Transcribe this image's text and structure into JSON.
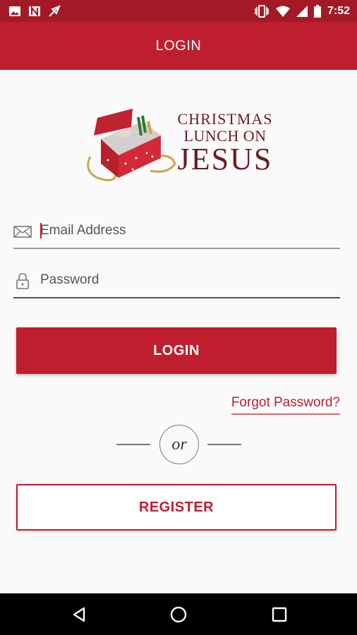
{
  "status_bar": {
    "time": "7:52",
    "left_icons": [
      "image-icon",
      "n-app-icon",
      "feather-icon"
    ],
    "right_icons": [
      "vibrate-icon",
      "wifi-icon",
      "cell-signal-icon",
      "battery-icon"
    ]
  },
  "app_bar": {
    "title": "LOGIN"
  },
  "logo": {
    "line1": "CHRISTMAS",
    "line2": "LUNCH ON",
    "line3": "JESUS",
    "image_icon": "gift-box-icon"
  },
  "form": {
    "email": {
      "placeholder": "Email Address",
      "value": "",
      "icon": "envelope-icon"
    },
    "password": {
      "placeholder": "Password",
      "value": "",
      "icon": "lock-icon"
    },
    "login_label": "LOGIN",
    "forgot_label": "Forgot Password?",
    "divider_text": "or",
    "register_label": "REGISTER"
  },
  "nav_bar": {
    "icons": [
      "back-icon",
      "home-icon",
      "recents-icon"
    ]
  },
  "colors": {
    "primary": "#be1e2d",
    "status_bar": "#a31a26",
    "logo_text": "#6b1a22",
    "background": "#fafafa"
  }
}
